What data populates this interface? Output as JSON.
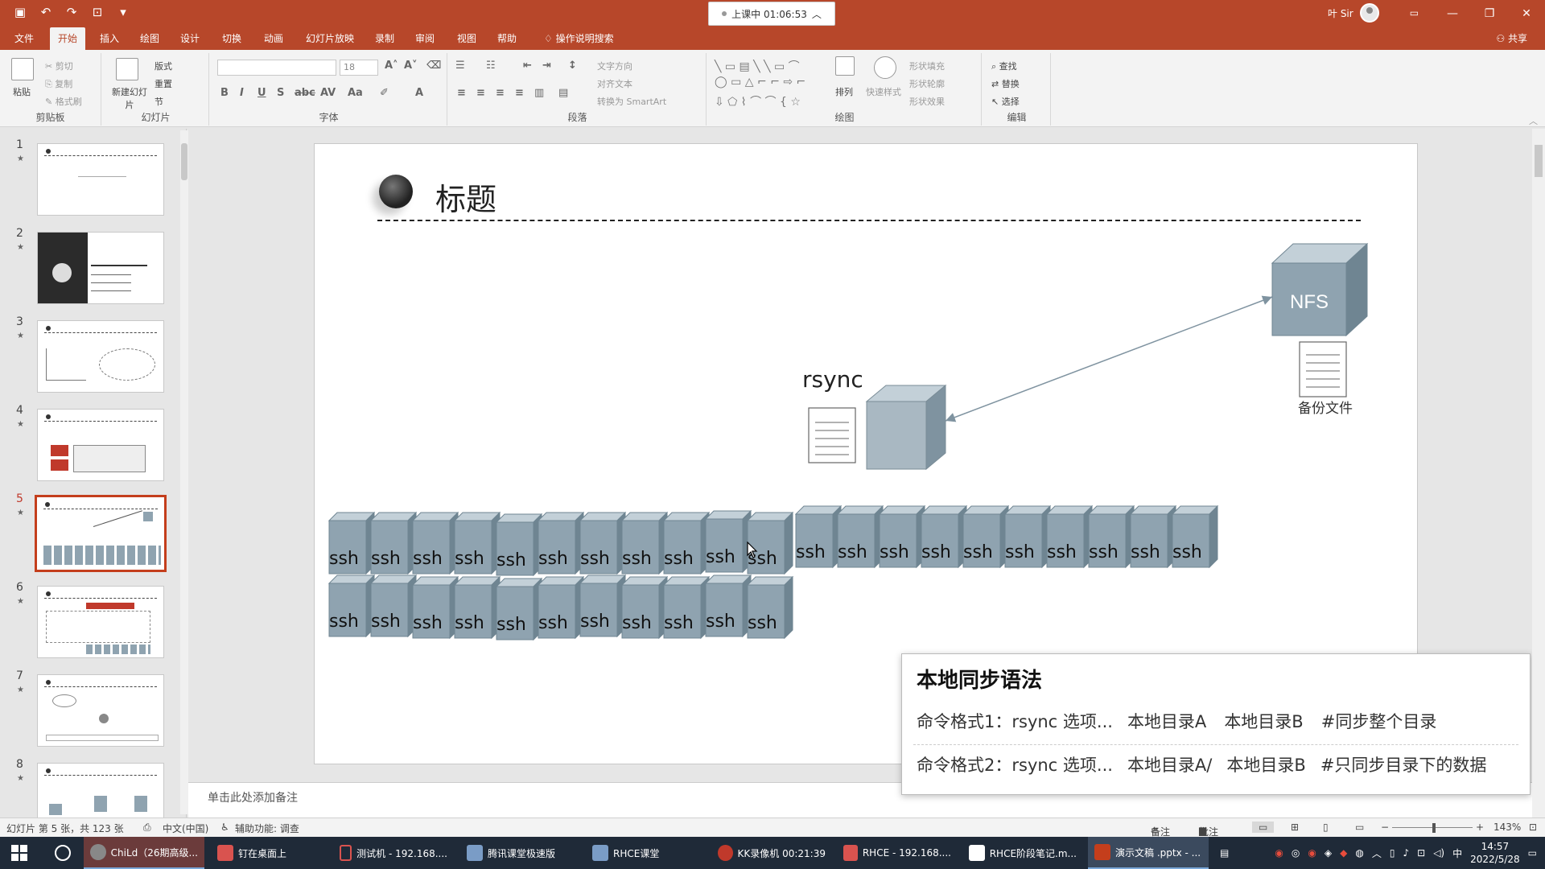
{
  "titlebar": {
    "timer": "上课中 01:06:53",
    "user": "叶 Sir",
    "controls": [
      "—",
      "❐",
      "✕"
    ]
  },
  "tabs": [
    {
      "label": "文件"
    },
    {
      "label": "开始"
    },
    {
      "label": "插入"
    },
    {
      "label": "绘图"
    },
    {
      "label": "设计"
    },
    {
      "label": "切换"
    },
    {
      "label": "动画"
    },
    {
      "label": "幻灯片放映"
    },
    {
      "label": "录制"
    },
    {
      "label": "审阅"
    },
    {
      "label": "视图"
    },
    {
      "label": "帮助"
    },
    {
      "label": "操作说明搜索"
    }
  ],
  "share_label": "共享",
  "ribbon": {
    "clipboard": {
      "paste": "粘贴",
      "cut": "剪切",
      "copy": "复制",
      "format": "格式刷",
      "label": "剪贴板"
    },
    "slides": {
      "new": "新建幻灯片",
      "layout": "版式",
      "reset": "重置",
      "section": "节",
      "label": "幻灯片"
    },
    "font": {
      "size": "18",
      "label": "字体"
    },
    "paragraph": {
      "text_dir": "文字方向",
      "align_text": "对齐文本",
      "smartart": "转换为 SmartArt",
      "label": "段落"
    },
    "drawing": {
      "arrange": "排列",
      "quick_styles": "快速样式",
      "fill": "形状填充",
      "outline": "形状轮廓",
      "effects": "形状效果",
      "label": "绘图"
    },
    "editing": {
      "find": "查找",
      "replace": "替换",
      "select": "选择",
      "label": "编辑"
    }
  },
  "thumbnails": [
    {
      "num": "1"
    },
    {
      "num": "2"
    },
    {
      "num": "3"
    },
    {
      "num": "4"
    },
    {
      "num": "5"
    },
    {
      "num": "6"
    },
    {
      "num": "7"
    },
    {
      "num": "8"
    }
  ],
  "slide": {
    "title": "标题",
    "rsync_label": "rsync",
    "nfs_label": "NFS",
    "backup_label": "备份文件",
    "ssh_label": "ssh"
  },
  "card": {
    "title": "本地同步语法",
    "line1": {
      "prefix": "命令格式1：",
      "cmd": "rsync 选项...",
      "a": "本地目录A",
      "b": "本地目录B",
      "comment": "#同步整个目录"
    },
    "line2": {
      "prefix": "命令格式2：",
      "cmd": "rsync 选项...",
      "a": "本地目录A/",
      "b": "本地目录B",
      "comment": "#只同步目录下的数据"
    }
  },
  "notes_placeholder": "单击此处添加备注",
  "status": {
    "slide_info": "幻灯片 第 5 张，共 123 张",
    "language": "中文(中国)",
    "accessibility": "辅助功能: 调查",
    "notes": "备注",
    "comments": "批注",
    "zoom": "143%"
  },
  "taskbar": {
    "items": [
      {
        "label": "ChiLd（26期高级..."
      },
      {
        "label": "钉在桌面上"
      },
      {
        "label": "测试机 - 192.168...."
      },
      {
        "label": "腾讯课堂极速版"
      },
      {
        "label": "RHCE课堂"
      },
      {
        "label": "KK录像机 00:21:39"
      },
      {
        "label": "RHCE - 192.168...."
      },
      {
        "label": "RHCE阶段笔记.m..."
      },
      {
        "label": "演示文稿 .pptx - ..."
      }
    ],
    "time": "14:57",
    "date": "2022/5/28",
    "ime": "中"
  },
  "colors": {
    "accent": "#b7472a",
    "cube_face": "#8fa3b0",
    "cube_top": "#c3d0d8",
    "cube_side": "#6f8592"
  }
}
